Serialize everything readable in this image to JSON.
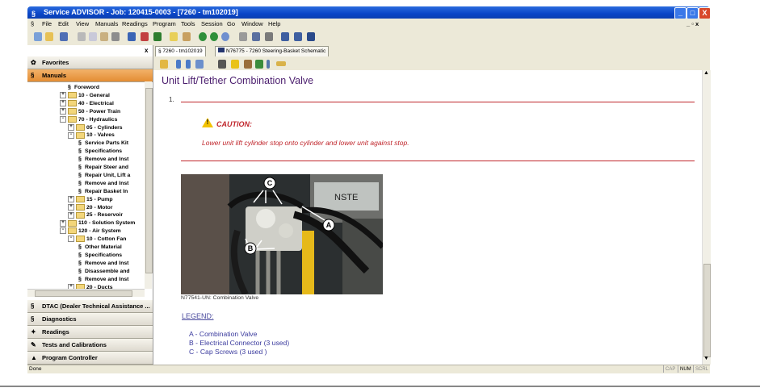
{
  "window": {
    "title": "Service ADVISOR - Job: 120415-0003 - [7260 - tm102019]",
    "controls": [
      "_",
      "□",
      "X"
    ],
    "mdi_controls": "_ ▫ x"
  },
  "menu": [
    "File",
    "Edit",
    "View",
    "Manuals",
    "Readings",
    "Program",
    "Tools",
    "Session",
    "Go",
    "Window",
    "Help"
  ],
  "left_panel": {
    "close_glyph": "x",
    "favorites_label": "Favorites",
    "manuals_label": "Manuals",
    "bottom_sections": [
      "DTAC (Dealer Technical Assistance ...",
      "Diagnostics",
      "Readings",
      "Tests and Calibrations",
      "Program Controller"
    ],
    "tree": [
      {
        "label": "Foreword",
        "type": "doc",
        "level": 2
      },
      {
        "label": "10 - General",
        "type": "folder",
        "level": 1,
        "toggle": "+"
      },
      {
        "label": "40 - Electrical",
        "type": "folder",
        "level": 1,
        "toggle": "+"
      },
      {
        "label": "50 - Power Train",
        "type": "folder",
        "level": 1,
        "toggle": "+"
      },
      {
        "label": "70 - Hydraulics",
        "type": "folder",
        "level": 1,
        "toggle": "-"
      },
      {
        "label": "05 - Cylinders",
        "type": "folder",
        "level": 2,
        "toggle": "+"
      },
      {
        "label": "10 - Valves",
        "type": "folder",
        "level": 2,
        "toggle": "-"
      },
      {
        "label": "Service Parts Kit",
        "type": "doc",
        "level": 3
      },
      {
        "label": "Specifications",
        "type": "doc",
        "level": 3
      },
      {
        "label": "Remove and Inst",
        "type": "doc",
        "level": 3
      },
      {
        "label": "Repair Steer and",
        "type": "doc",
        "level": 3
      },
      {
        "label": "Repair Unit, Lift a",
        "type": "doc",
        "level": 3
      },
      {
        "label": "Remove and Inst",
        "type": "doc",
        "level": 3
      },
      {
        "label": "Repair Basket In",
        "type": "doc",
        "level": 3
      },
      {
        "label": "15 - Pump",
        "type": "folder",
        "level": 2,
        "toggle": "+"
      },
      {
        "label": "20 - Motor",
        "type": "folder",
        "level": 2,
        "toggle": "+"
      },
      {
        "label": "25 - Reservoir",
        "type": "folder",
        "level": 2,
        "toggle": "+"
      },
      {
        "label": "110 - Solution System",
        "type": "folder",
        "level": 1,
        "toggle": "+"
      },
      {
        "label": "120 - Air System",
        "type": "folder",
        "level": 1,
        "toggle": "-"
      },
      {
        "label": "10 - Cotton Fan",
        "type": "folder",
        "level": 2,
        "toggle": "-"
      },
      {
        "label": "Other Material",
        "type": "doc",
        "level": 3
      },
      {
        "label": "Specifications",
        "type": "doc",
        "level": 3
      },
      {
        "label": "Remove and Inst",
        "type": "doc",
        "level": 3
      },
      {
        "label": "Disassemble and",
        "type": "doc",
        "level": 3
      },
      {
        "label": "Remove and Inst",
        "type": "doc",
        "level": 3
      },
      {
        "label": "20 - Ducts",
        "type": "folder",
        "level": 2,
        "toggle": "+"
      }
    ]
  },
  "tabs": [
    {
      "label": "7260 - tm102019",
      "active": true
    },
    {
      "label": "N76775 - 7260 Steering-Basket Schematic",
      "active": false
    }
  ],
  "document": {
    "title": "Unit Lift/Tether Combination Valve",
    "step": "1.",
    "caution_label": "CAUTION:",
    "caution_text": "Lower unit lift cylinder stop onto cylinder and lower unit against stop.",
    "caption": "N77541-UN: Combination Valve",
    "callouts": [
      "A",
      "B",
      "C"
    ],
    "photo_text": "NSTE",
    "legend_title": "LEGEND:",
    "legend": [
      "A - Combination Valve",
      "B - Electrical Connector (3 used)",
      "C - Cap Screws (3 used )"
    ]
  },
  "status": {
    "text": "Done",
    "indicators": [
      "CAP",
      "NUM",
      "SCRL"
    ]
  },
  "colors": {
    "title_purple": "#4b1e6e",
    "caution_red": "#c0262c",
    "legend_blue": "#3b3b9e",
    "selected_orange": "#e48d33"
  }
}
